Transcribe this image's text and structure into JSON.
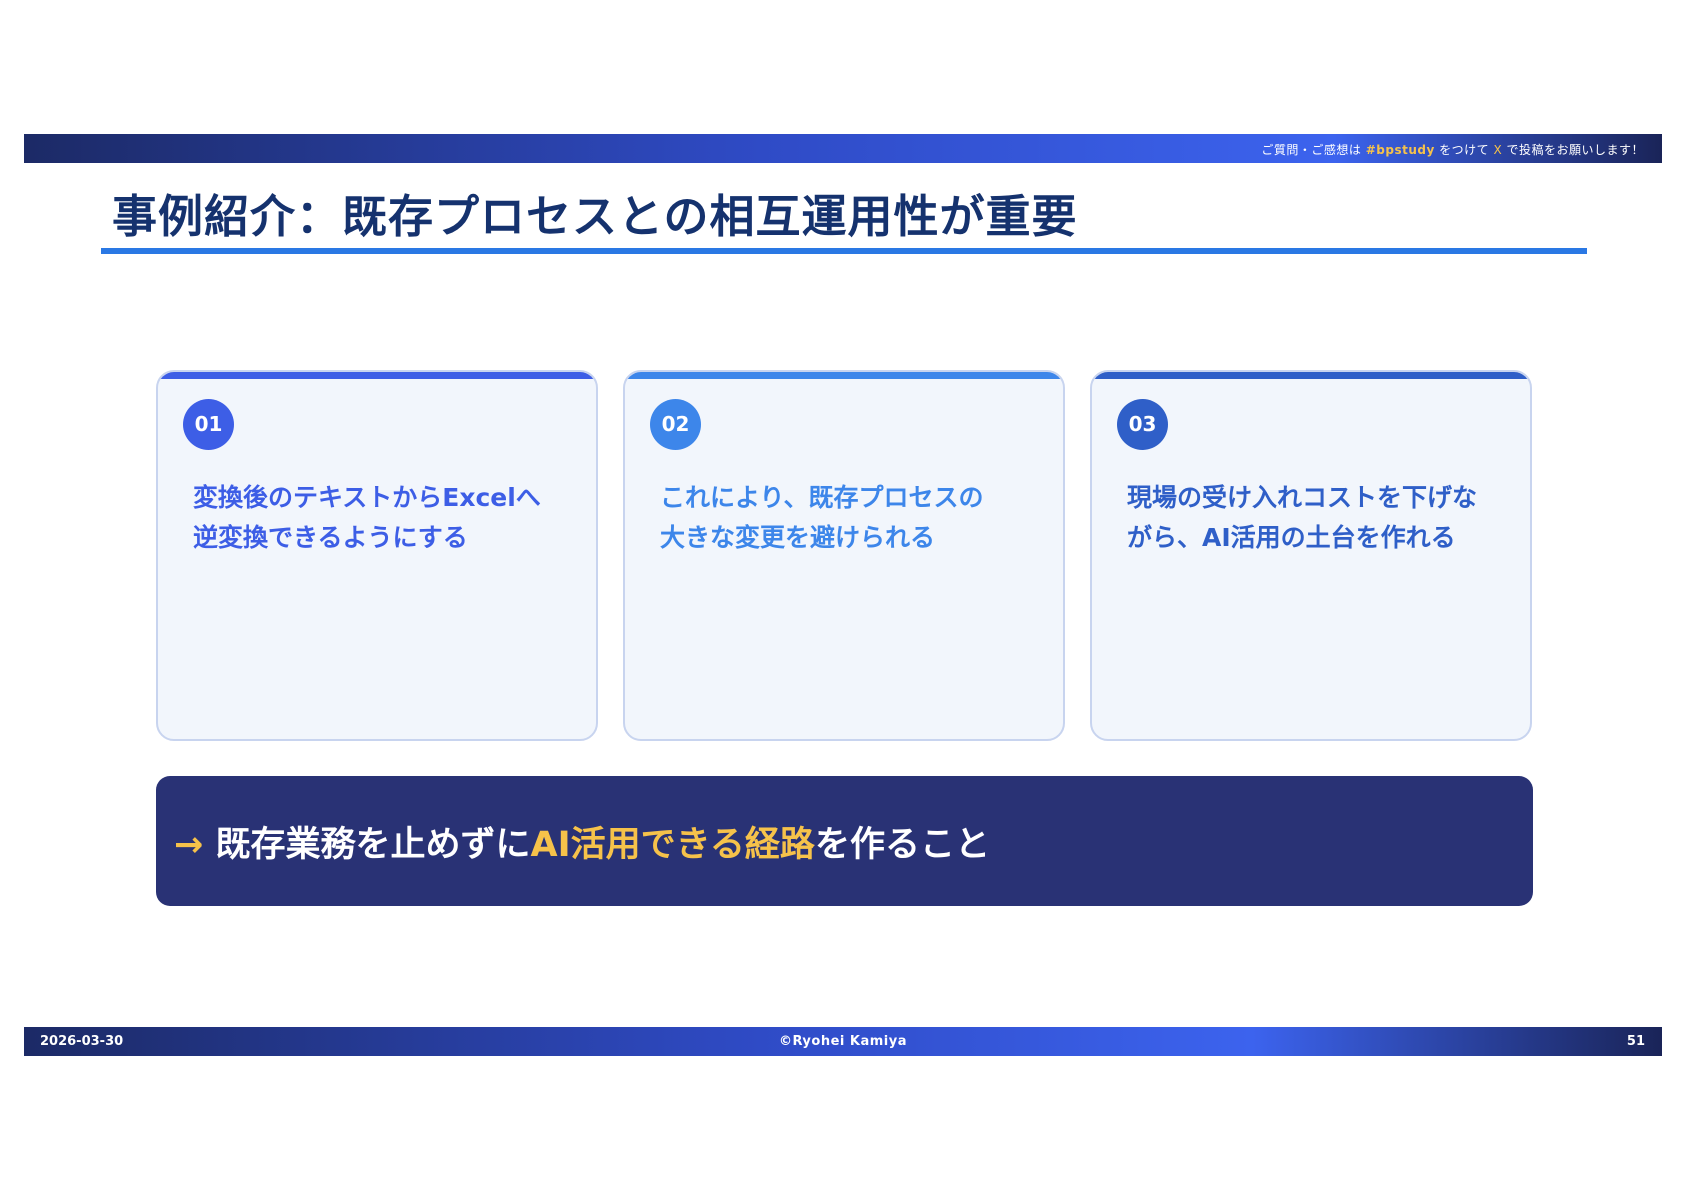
{
  "header": {
    "note_pre": "ご質問・ご感想は ",
    "hashtag": "#bpstudy",
    "note_mid": " をつけて ",
    "x_label": "X",
    "note_post": " で投稿をお願いします！"
  },
  "title": "事例紹介：既存プロセスとの相互運用性が重要",
  "cards": [
    {
      "number": "01",
      "line1": "変換後のテキストからExcelへ",
      "line2": "逆変換できるようにする",
      "color": "#3d5ee6"
    },
    {
      "number": "02",
      "line1": "これにより、既存プロセスの",
      "line2": "大きな変更を避けられる",
      "color": "#3d86ea"
    },
    {
      "number": "03",
      "line1": "現場の受け入れコストを下げな",
      "line2": "がら、AI活用の土台を作れる",
      "color": "#2f5fc8"
    }
  ],
  "conclusion": {
    "arrow": "→",
    "pre": " 既存業務を止めずに",
    "highlight": "AI活用できる経路",
    "post": "を作ること"
  },
  "footer": {
    "date": "2026-03-30",
    "copyright": "©Ryohei Kamiya",
    "page": "51"
  },
  "colors": {
    "title": "#15326e",
    "accent_yellow": "#f6c24a",
    "conclusion_bg": "#293275",
    "rule_blue": "#2a78e4"
  }
}
